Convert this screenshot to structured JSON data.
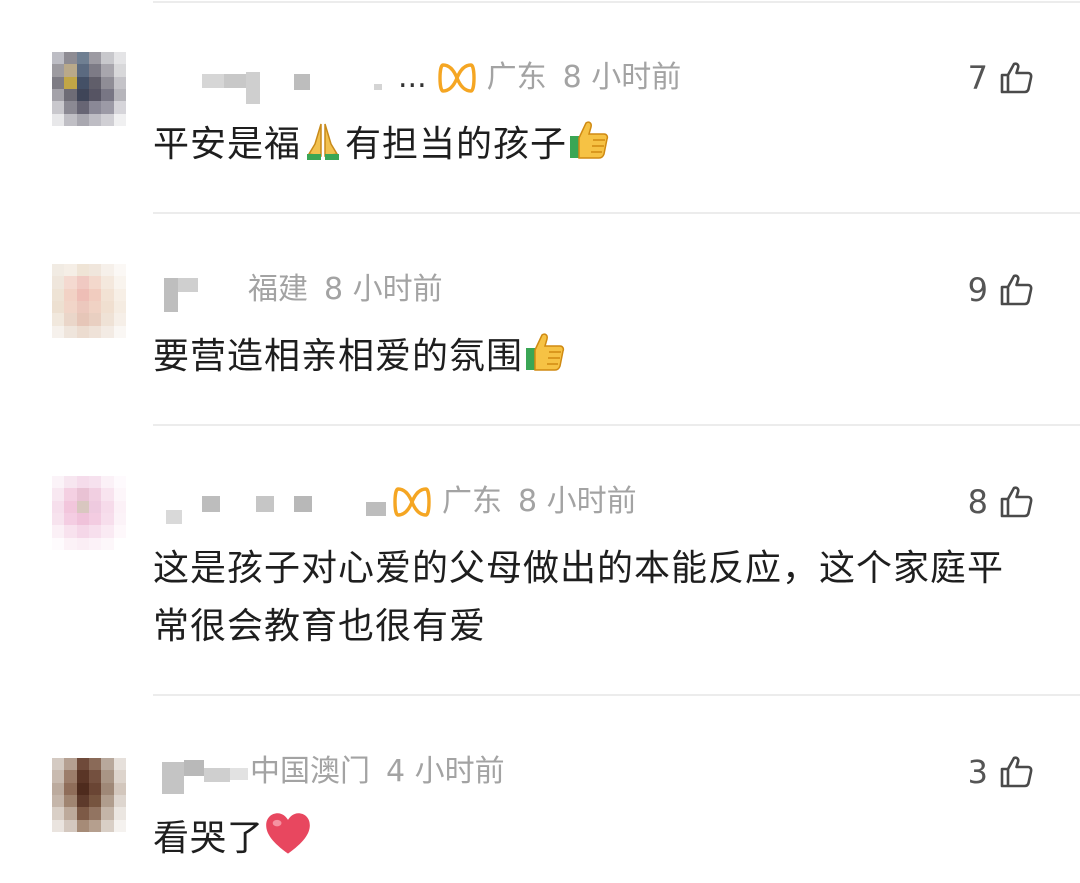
{
  "comments": [
    {
      "location": "广东",
      "time": "8 小时前",
      "likes": "7",
      "text_parts": [
        "平安是福",
        "有担当的孩子"
      ],
      "emojis": [
        "praying-hands",
        "thumbs-up"
      ],
      "badge": "orange-ribbon-badge",
      "name_suffix": "..."
    },
    {
      "location": "福建",
      "time": "8 小时前",
      "likes": "9",
      "text_parts": [
        "要营造相亲相爱的氛围"
      ],
      "emojis": [
        "thumbs-up"
      ]
    },
    {
      "location": "广东",
      "time": "8 小时前",
      "likes": "8",
      "text_parts": [
        "这是孩子对心爱的父母做出的本能反应，这个家庭平常很会教育也很有爱"
      ],
      "badge": "orange-ribbon-badge"
    },
    {
      "location": "中国澳门",
      "time": "4 小时前",
      "likes": "3",
      "text_parts": [
        "看哭了"
      ],
      "emojis": [
        "red-heart"
      ]
    }
  ],
  "colors": {
    "meta": "#a3a3a3",
    "text": "#1e1e1e",
    "badge": "#f5a623",
    "heart": "#e8475f",
    "divider": "#ececec"
  }
}
